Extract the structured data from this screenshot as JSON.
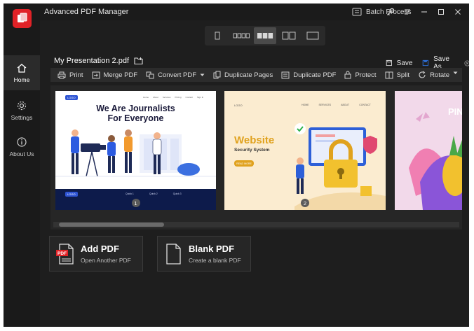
{
  "app": {
    "title": "Advanced PDF Manager",
    "batch_label": "Batch Process"
  },
  "colors": {
    "accent": "#e02227",
    "brand_blue": "#2d6fd8",
    "dark": "#1e1e1e"
  },
  "sidebar": {
    "items": [
      {
        "label": "Home",
        "icon": "home-icon",
        "active": true
      },
      {
        "label": "Settings",
        "icon": "gear-icon",
        "active": false
      },
      {
        "label": "About Us",
        "icon": "info-icon",
        "active": false
      }
    ]
  },
  "view_modes": [
    "single-page-view",
    "small-thumbnails-view",
    "medium-thumbnails-view",
    "two-page-view",
    "large-page-view"
  ],
  "document": {
    "filename": "My Presentation 2.pdf",
    "save_label": "Save",
    "save_as_label": "Save As"
  },
  "toolbar": {
    "print": "Print",
    "merge": "Merge PDF",
    "convert": "Convert PDF",
    "duplicate_pages": "Duplicate Pages",
    "duplicate_pdf": "Duplicate PDF",
    "protect": "Protect",
    "split": "Split",
    "rotate": "Rotate"
  },
  "pages": [
    {
      "number": "1",
      "logo": "LOGO",
      "nav": [
        "Home",
        "About",
        "Services",
        "Pricing",
        "Contact",
        "Sign In"
      ],
      "heading_line1": "We Are Journalists",
      "heading_line2": "For Everyone",
      "footer": [
        "Quick 1",
        "Quick 2",
        "Quick 3"
      ]
    },
    {
      "number": "2",
      "logo": "LOGO",
      "nav": [
        "HOME",
        "SERVICES",
        "ABOUT",
        "CONTACT"
      ],
      "title": "Website",
      "subtitle": "Security System",
      "button": "READ MORE"
    },
    {
      "partial_text": "PIN"
    }
  ],
  "actions": {
    "add_pdf": {
      "title": "Add PDF",
      "subtitle": "Open Another PDF",
      "badge": "PDF"
    },
    "blank_pdf": {
      "title": "Blank PDF",
      "subtitle": "Create a blank PDF"
    }
  }
}
